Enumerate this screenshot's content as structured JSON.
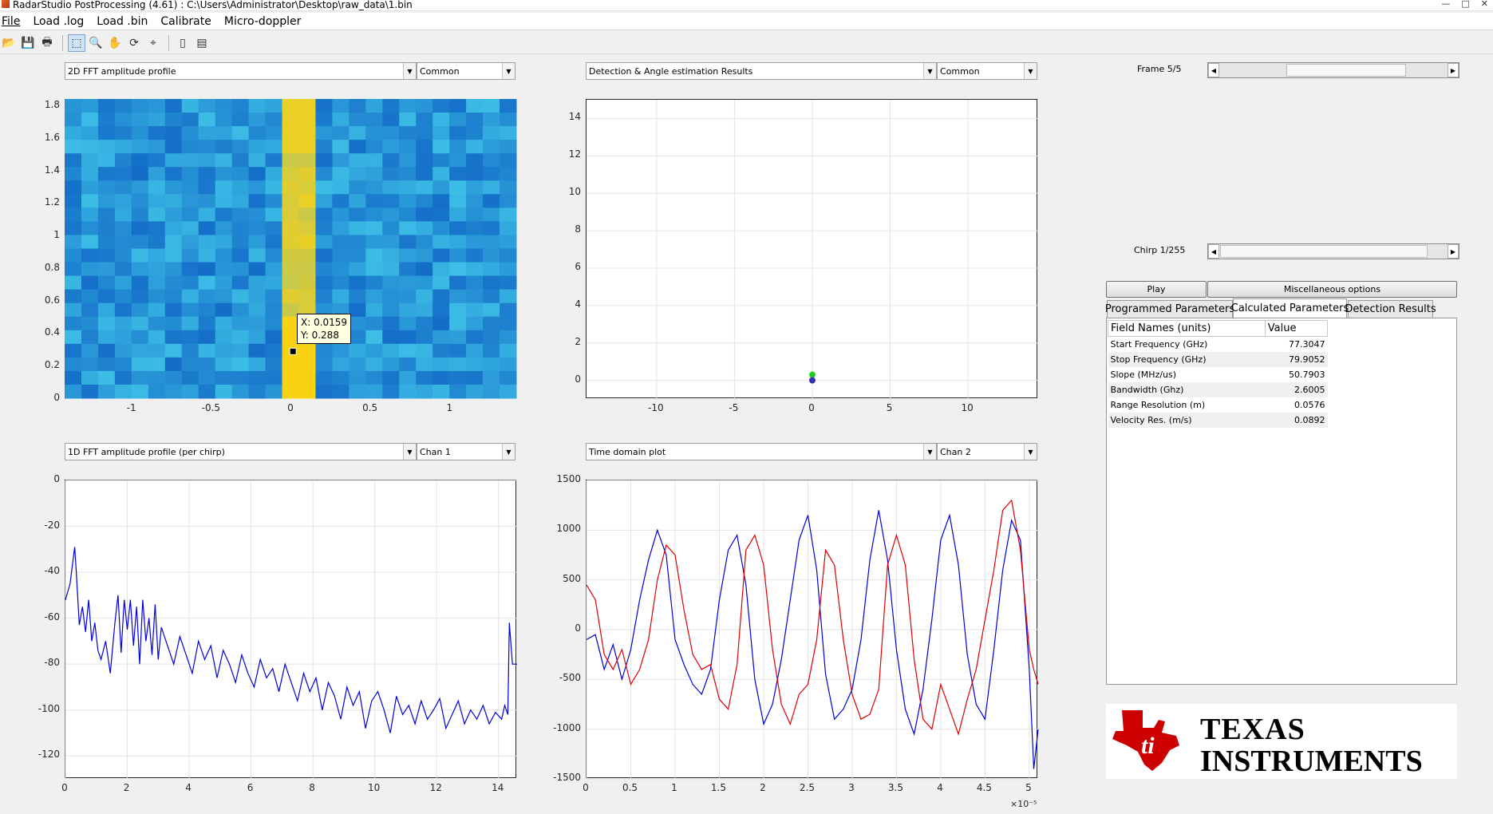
{
  "window": {
    "title": "RadarStudio PostProcessing (4.61)  : C:\\Users\\Administrator\\Desktop\\raw_data\\1.bin",
    "controls": [
      "—",
      "□",
      "✕"
    ]
  },
  "menu": [
    "File",
    "Load .log",
    "Load .bin",
    "Calibrate",
    "Micro-doppler"
  ],
  "toolbar": {
    "icons": [
      "open-icon",
      "save-icon",
      "print-icon",
      "select-icon",
      "zoom-in-icon",
      "pan-icon",
      "rotate-icon",
      "data-cursor-icon",
      "colorbar-icon",
      "legend-icon"
    ],
    "glyphs": [
      "📂",
      "💾",
      "🖶",
      "⬚",
      "🔍",
      "✋",
      "⟳",
      "⌖",
      "▯",
      "▤"
    ]
  },
  "plots": {
    "tl": {
      "select": "2D FFT amplitude profile",
      "option": "Common"
    },
    "tr": {
      "select": "Detection & Angle estimation Results",
      "option": "Common"
    },
    "bl": {
      "select": "1D FFT amplitude profile (per chirp)",
      "option": "Chan 1"
    },
    "br": {
      "select": "Time domain plot",
      "option": "Chan 2"
    }
  },
  "datatip": {
    "x_text": "X: 0.0159",
    "y_text": "Y: 0.288"
  },
  "frame": {
    "label": "Frame 5/5",
    "position": 0.62
  },
  "chirp": {
    "label": "Chirp 1/255",
    "position": 0.0
  },
  "buttons": {
    "play": "Play",
    "misc": "Miscellaneous options"
  },
  "tabs": [
    "Programmed Parameters",
    "Calculated Parameters",
    "Detection Results"
  ],
  "active_tab": 1,
  "table": {
    "headers": [
      "Field Names    (units)",
      "Value"
    ],
    "rows": [
      [
        "Start Frequency (GHz)",
        "77.3047"
      ],
      [
        "Stop Frequency (GHz)",
        "79.9052"
      ],
      [
        "Slope (MHz/us)",
        "50.7903"
      ],
      [
        "Bandwidth (Ghz)",
        "2.6005"
      ],
      [
        "Range Resolution (m)",
        "0.0576"
      ],
      [
        "Velocity Res. (m/s)",
        "0.0892"
      ]
    ]
  },
  "logo": {
    "line1": "TEXAS",
    "line2": "INSTRUMENTS",
    "color": "#cc0000"
  },
  "chart_data": [
    {
      "type": "heatmap",
      "title": "",
      "xlim": [
        -1.42,
        1.42
      ],
      "ylim": [
        0,
        1.84
      ],
      "xticks": [
        -1,
        -0.5,
        0,
        0.5,
        1
      ],
      "xticklabels": [
        "-1",
        "-0.5",
        "0",
        "0.5",
        "1"
      ],
      "yticks": [
        0,
        0.2,
        0.4,
        0.6,
        0.8,
        1,
        1.2,
        1.4,
        1.6,
        1.8
      ],
      "yticklabels": [
        "0",
        "0.2",
        "0.4",
        "0.6",
        "0.8",
        "1",
        "1.2",
        "1.4",
        "1.6",
        "1.8"
      ],
      "highlight_band_x": [
        -0.09,
        0.18
      ],
      "datatip_point": [
        0.0159,
        0.288
      ]
    },
    {
      "type": "scatter",
      "xlim": [
        -14.5,
        14.5
      ],
      "ylim": [
        -1,
        15
      ],
      "xticks": [
        -10,
        -5,
        0,
        5,
        10
      ],
      "xticklabels": [
        "-10",
        "-5",
        "0",
        "5",
        "10"
      ],
      "yticks": [
        0,
        2,
        4,
        6,
        8,
        10,
        12,
        14
      ],
      "yticklabels": [
        "0",
        "2",
        "4",
        "6",
        "8",
        "10",
        "12",
        "14"
      ],
      "grid": true,
      "points": [
        {
          "x": 0,
          "y": 0.3,
          "color": "#22cc22"
        },
        {
          "x": 0,
          "y": 0.0,
          "color": "#3030b0"
        }
      ]
    },
    {
      "type": "line",
      "xlim": [
        0,
        14.6
      ],
      "ylim": [
        -130,
        0
      ],
      "xticks": [
        0,
        2,
        4,
        6,
        8,
        10,
        12,
        14
      ],
      "xticklabels": [
        "0",
        "2",
        "4",
        "6",
        "8",
        "10",
        "12",
        "14"
      ],
      "yticks": [
        0,
        -20,
        -40,
        -60,
        -80,
        -100,
        -120
      ],
      "yticklabels": [
        "0",
        "-20",
        "-40",
        "-60",
        "-80",
        "-100",
        "-120"
      ],
      "grid": true,
      "series": [
        {
          "color": "#0000dd",
          "x": [
            0,
            0.15,
            0.3,
            0.35,
            0.45,
            0.55,
            0.65,
            0.75,
            0.85,
            0.95,
            1.05,
            1.15,
            1.3,
            1.45,
            1.6,
            1.7,
            1.8,
            1.9,
            2.0,
            2.1,
            2.2,
            2.3,
            2.4,
            2.5,
            2.6,
            2.7,
            2.8,
            2.9,
            3.0,
            3.1,
            3.3,
            3.5,
            3.7,
            3.9,
            4.1,
            4.3,
            4.5,
            4.7,
            4.9,
            5.1,
            5.3,
            5.5,
            5.7,
            5.9,
            6.1,
            6.3,
            6.5,
            6.7,
            6.9,
            7.1,
            7.3,
            7.5,
            7.7,
            7.9,
            8.1,
            8.3,
            8.5,
            8.7,
            8.9,
            9.1,
            9.3,
            9.5,
            9.7,
            9.9,
            10.1,
            10.3,
            10.5,
            10.7,
            10.9,
            11.1,
            11.3,
            11.5,
            11.7,
            11.9,
            12.1,
            12.3,
            12.5,
            12.7,
            12.9,
            13.1,
            13.3,
            13.5,
            13.7,
            13.9,
            14.1,
            14.2,
            14.3,
            14.35,
            14.45,
            14.6
          ],
          "y": [
            -52,
            -45,
            -29,
            -40,
            -63,
            -55,
            -66,
            -52,
            -70,
            -62,
            -74,
            -78,
            -70,
            -84,
            -62,
            -50,
            -75,
            -52,
            -65,
            -52,
            -72,
            -55,
            -80,
            -52,
            -70,
            -60,
            -76,
            -54,
            -78,
            -64,
            -72,
            -80,
            -68,
            -76,
            -84,
            -70,
            -78,
            -72,
            -86,
            -74,
            -80,
            -88,
            -76,
            -84,
            -90,
            -78,
            -86,
            -82,
            -92,
            -80,
            -88,
            -96,
            -84,
            -92,
            -86,
            -100,
            -88,
            -94,
            -104,
            -90,
            -98,
            -92,
            -108,
            -96,
            -92,
            -100,
            -110,
            -94,
            -102,
            -98,
            -106,
            -96,
            -104,
            -100,
            -95,
            -108,
            -102,
            -96,
            -106,
            -100,
            -104,
            -98,
            -106,
            -101,
            -104,
            -98,
            -102,
            -62,
            -80,
            -80
          ]
        }
      ]
    },
    {
      "type": "line",
      "xlim": [
        0,
        5.1
      ],
      "ylim": [
        -1500,
        1500
      ],
      "xticks": [
        0,
        0.5,
        1,
        1.5,
        2,
        2.5,
        3,
        3.5,
        4,
        4.5,
        5
      ],
      "xticklabels": [
        "0",
        "0.5",
        "1",
        "1.5",
        "2",
        "2.5",
        "3",
        "3.5",
        "4",
        "4.5",
        "5"
      ],
      "yticks": [
        1500,
        1000,
        500,
        0,
        -500,
        -1000,
        -1500
      ],
      "yticklabels": [
        "1500",
        "1000",
        "500",
        "0",
        "-500",
        "-1000",
        "-1500"
      ],
      "x_exponent": "×10⁻⁵",
      "grid": true,
      "series": [
        {
          "color": "#0000dd",
          "x": [
            0,
            0.1,
            0.2,
            0.3,
            0.4,
            0.5,
            0.6,
            0.7,
            0.8,
            0.9,
            1.0,
            1.1,
            1.2,
            1.3,
            1.4,
            1.5,
            1.6,
            1.7,
            1.8,
            1.9,
            2.0,
            2.1,
            2.2,
            2.3,
            2.4,
            2.5,
            2.6,
            2.7,
            2.8,
            2.9,
            3.0,
            3.1,
            3.2,
            3.3,
            3.4,
            3.5,
            3.6,
            3.7,
            3.8,
            3.9,
            4.0,
            4.1,
            4.2,
            4.3,
            4.4,
            4.5,
            4.6,
            4.7,
            4.8,
            4.9,
            5.0,
            5.05,
            5.1
          ],
          "y": [
            -100,
            -50,
            -400,
            -150,
            -500,
            -200,
            300,
            700,
            1000,
            750,
            -100,
            -350,
            -550,
            -650,
            -400,
            300,
            800,
            950,
            450,
            -500,
            -950,
            -750,
            -300,
            300,
            900,
            1150,
            600,
            -450,
            -900,
            -800,
            -600,
            -100,
            700,
            1200,
            700,
            -200,
            -800,
            -1050,
            -600,
            100,
            900,
            1150,
            650,
            -250,
            -750,
            -900,
            -200,
            600,
            1100,
            900,
            -400,
            -1400,
            -1000
          ]
        },
        {
          "color": "#dd0000",
          "x": [
            0,
            0.1,
            0.2,
            0.3,
            0.4,
            0.5,
            0.6,
            0.7,
            0.8,
            0.9,
            1.0,
            1.1,
            1.2,
            1.3,
            1.4,
            1.5,
            1.6,
            1.7,
            1.8,
            1.9,
            2.0,
            2.1,
            2.2,
            2.3,
            2.4,
            2.5,
            2.6,
            2.7,
            2.8,
            2.9,
            3.0,
            3.1,
            3.2,
            3.3,
            3.4,
            3.5,
            3.6,
            3.7,
            3.8,
            3.9,
            4.0,
            4.1,
            4.2,
            4.3,
            4.4,
            4.5,
            4.6,
            4.7,
            4.8,
            4.9,
            5.0,
            5.05,
            5.1
          ],
          "y": [
            450,
            300,
            -250,
            -400,
            -200,
            -550,
            -400,
            -100,
            500,
            850,
            750,
            200,
            -250,
            -400,
            -350,
            -700,
            -800,
            -350,
            800,
            950,
            650,
            -200,
            -750,
            -950,
            -650,
            -550,
            -100,
            800,
            650,
            -100,
            -650,
            -900,
            -850,
            -600,
            650,
            950,
            650,
            -300,
            -900,
            -1000,
            -550,
            -800,
            -1050,
            -700,
            -400,
            100,
            600,
            1200,
            1300,
            800,
            -200,
            -400,
            -550
          ]
        }
      ]
    }
  ]
}
